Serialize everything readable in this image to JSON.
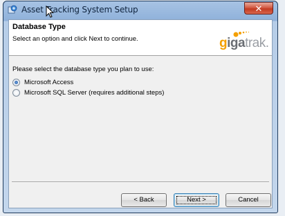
{
  "window": {
    "title": "Asset Tracking System Setup",
    "close_label": "✕"
  },
  "header": {
    "title": "Database Type",
    "subtitle": "Select an option and click Next to continue.",
    "logo_parts": [
      "g",
      "iga",
      "trak."
    ]
  },
  "main": {
    "prompt": "Please select the database type you plan to use:",
    "options": [
      {
        "label": "Microsoft Access",
        "selected": true
      },
      {
        "label": "Microsoft SQL Server (requires additional steps)",
        "selected": false
      }
    ]
  },
  "buttons": {
    "back": "< Back",
    "next": "Next >",
    "cancel": "Cancel"
  },
  "colors": {
    "accent": "#f4a000",
    "titlebar": "#a7c3e4",
    "close": "#c23b22"
  }
}
